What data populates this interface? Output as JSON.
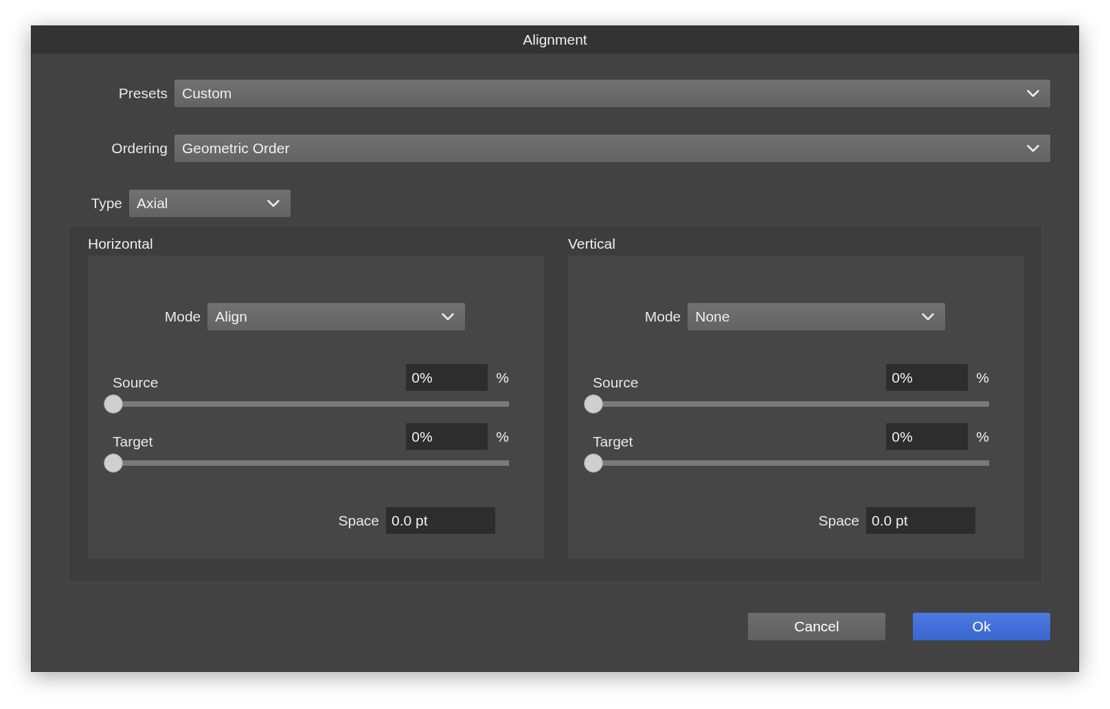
{
  "window": {
    "title": "Alignment"
  },
  "presets": {
    "label": "Presets",
    "value": "Custom"
  },
  "ordering": {
    "label": "Ordering",
    "value": "Geometric Order"
  },
  "type": {
    "label": "Type",
    "value": "Axial"
  },
  "axes": [
    {
      "title": "Horizontal",
      "mode": {
        "label": "Mode",
        "value": "Align"
      },
      "sliders": [
        {
          "label": "Source",
          "value": "0%",
          "unit": "%",
          "level": 0
        },
        {
          "label": "Target",
          "value": "0%",
          "unit": "%",
          "level": 0
        }
      ],
      "space": {
        "label": "Space",
        "value": "0.0 pt"
      }
    },
    {
      "title": "Vertical",
      "mode": {
        "label": "Mode",
        "value": "None"
      },
      "sliders": [
        {
          "label": "Source",
          "value": "0%",
          "unit": "%",
          "level": 0
        },
        {
          "label": "Target",
          "value": "0%",
          "unit": "%",
          "level": 0
        }
      ],
      "space": {
        "label": "Space",
        "value": "0.0 pt"
      }
    }
  ],
  "buttons": [
    {
      "label": "Cancel",
      "primary": false
    },
    {
      "label": "Ok",
      "primary": true
    }
  ]
}
